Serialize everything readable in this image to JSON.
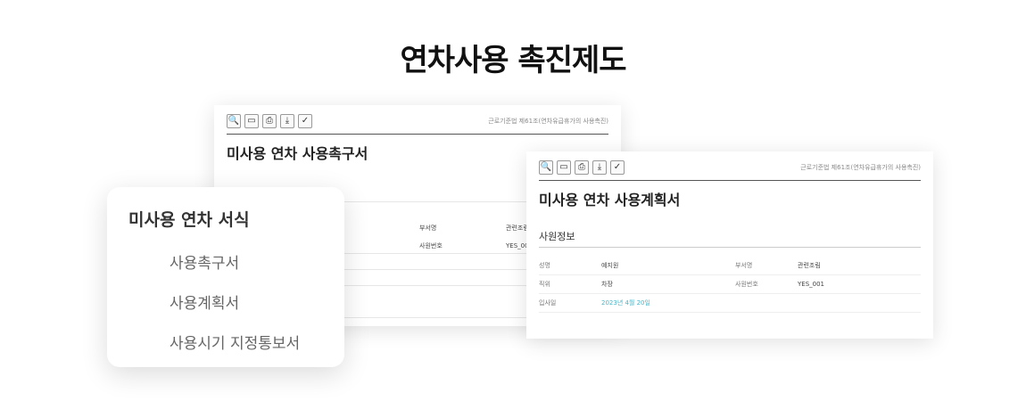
{
  "page": {
    "title": "연차사용 촉진제도"
  },
  "toolbar": {
    "buttons": [
      "search-icon",
      "monitor-icon",
      "print-icon",
      "download-icon",
      "check-icon"
    ],
    "glyphs": [
      "🔍",
      "▭",
      "⎙",
      "⤓",
      "✓"
    ]
  },
  "doc1": {
    "law_ref": "근로기준법 제61조(연차유급휴가의 사용촉진)",
    "title": "미사용 연차 사용촉구서",
    "table": {
      "headers": [
        "부서명",
        "관련조림"
      ],
      "row": [
        "사원번호",
        "YES_001"
      ]
    }
  },
  "doc2": {
    "law_ref": "근로기준법 제61조(연차유급휴가의 사용촉진)",
    "title": "미사용 연차 사용계획서",
    "section": "사원정보",
    "rows": [
      [
        "성명",
        "예지원",
        "부서명",
        "관련조림"
      ],
      [
        "직위",
        "차장",
        "사원번호",
        "YES_001"
      ],
      [
        "입사일",
        "2023년 4월 20일",
        "",
        ""
      ]
    ]
  },
  "menu": {
    "title": "미사용 연차 서식",
    "items": [
      "사용촉구서",
      "사용계획서",
      "사용시기 지정통보서"
    ]
  }
}
